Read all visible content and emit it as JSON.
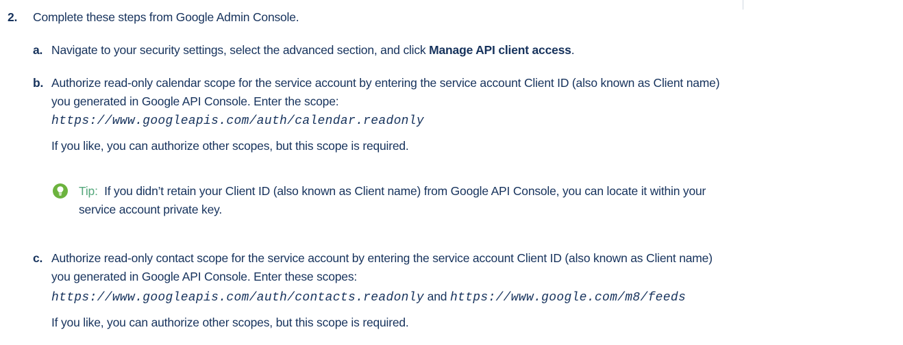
{
  "step": {
    "number": "2.",
    "text": "Complete these steps from Google Admin Console."
  },
  "substeps": {
    "a": {
      "letter": "a.",
      "text_before": "Navigate to your security settings, select the advanced section, and click ",
      "bold": "Manage API client access",
      "text_after": "."
    },
    "b": {
      "letter": "b.",
      "line1": "Authorize read-only calendar scope for the service account by entering the service account Client ID (also known as Client name)",
      "line2": "you generated in Google API Console. Enter the scope:",
      "scope": "https://www.googleapis.com/auth/calendar.readonly",
      "note": "If you like, you can authorize other scopes, but this scope is required."
    },
    "tip": {
      "label": "Tip",
      "colon": ":",
      "line1": "If you didn’t retain your Client ID (also known as Client name) from Google API Console, you can locate it within your",
      "line2": "service account private key."
    },
    "c": {
      "letter": "c.",
      "line1": "Authorize read-only contact scope for the service account by entering the service account Client ID (also known as Client name)",
      "line2": "you generated in Google API Console. Enter these scopes:",
      "scope1": "https://www.googleapis.com/auth/contacts.readonly",
      "joiner": " and ",
      "scope2": "https://www.google.com/m8/feeds",
      "note": "If you like, you can authorize other scopes, but this scope is required."
    }
  },
  "colors": {
    "text": "#16325c",
    "tip_green": "#54a77b",
    "tip_icon": "#6cb33e"
  },
  "icons": {
    "tip": "lightbulb-icon"
  }
}
